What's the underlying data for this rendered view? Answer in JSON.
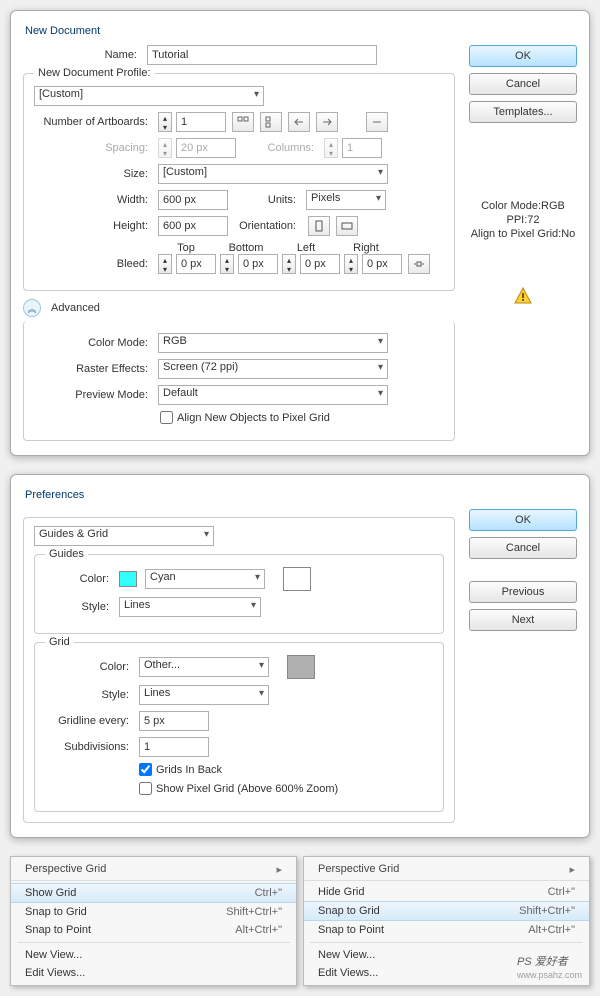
{
  "newdoc": {
    "title": "New Document",
    "name_label": "Name:",
    "name_value": "Tutorial",
    "profile_label": "New Document Profile:",
    "profile_value": "[Custom]",
    "artboards_label": "Number of Artboards:",
    "artboards_value": "1",
    "spacing_label": "Spacing:",
    "spacing_value": "20 px",
    "columns_label": "Columns:",
    "columns_value": "1",
    "size_label": "Size:",
    "size_value": "[Custom]",
    "width_label": "Width:",
    "width_value": "600 px",
    "units_label": "Units:",
    "units_value": "Pixels",
    "height_label": "Height:",
    "height_value": "600 px",
    "orientation_label": "Orientation:",
    "bleed_label": "Bleed:",
    "bleed": {
      "top_label": "Top",
      "top": "0 px",
      "bottom_label": "Bottom",
      "bottom": "0 px",
      "left_label": "Left",
      "left": "0 px",
      "right_label": "Right",
      "right": "0 px"
    },
    "advanced_label": "Advanced",
    "colormode_label": "Color Mode:",
    "colormode_value": "RGB",
    "raster_label": "Raster Effects:",
    "raster_value": "Screen (72 ppi)",
    "preview_label": "Preview Mode:",
    "preview_value": "Default",
    "align_label": "Align New Objects to Pixel Grid",
    "ok": "OK",
    "cancel": "Cancel",
    "templates": "Templates...",
    "info1": "Color Mode:RGB",
    "info2": "PPI:72",
    "info3": "Align to Pixel Grid:No"
  },
  "prefs": {
    "title": "Preferences",
    "section": "Guides & Grid",
    "guides_legend": "Guides",
    "guides_color_label": "Color:",
    "guides_color_value": "Cyan",
    "guides_swatch": "#33ffff",
    "guides_style_label": "Style:",
    "guides_style_value": "Lines",
    "grid_legend": "Grid",
    "grid_color_label": "Color:",
    "grid_color_value": "Other...",
    "grid_swatch": "#b0b0b0",
    "grid_style_label": "Style:",
    "grid_style_value": "Lines",
    "gridline_label": "Gridline every:",
    "gridline_value": "5 px",
    "subdiv_label": "Subdivisions:",
    "subdiv_value": "1",
    "gridsback_label": "Grids In Back",
    "showpixel_label": "Show Pixel Grid (Above 600% Zoom)",
    "ok": "OK",
    "cancel": "Cancel",
    "previous": "Previous",
    "next": "Next"
  },
  "menu1": {
    "head": "Perspective Grid",
    "items": [
      {
        "label": "Show Grid",
        "sc": "Ctrl+\"",
        "hl": true
      },
      {
        "label": "Snap to Grid",
        "sc": "Shift+Ctrl+\""
      },
      {
        "label": "Snap to Point",
        "sc": "Alt+Ctrl+\""
      }
    ],
    "tail": [
      {
        "label": "New View..."
      },
      {
        "label": "Edit Views..."
      }
    ]
  },
  "menu2": {
    "head": "Perspective Grid",
    "items": [
      {
        "label": "Hide Grid",
        "sc": "Ctrl+\""
      },
      {
        "label": "Snap to Grid",
        "sc": "Shift+Ctrl+\"",
        "hl": true
      },
      {
        "label": "Snap to Point",
        "sc": "Alt+Ctrl+\""
      }
    ],
    "tail": [
      {
        "label": "New View..."
      },
      {
        "label": "Edit Views..."
      }
    ]
  },
  "watermark": {
    "brand": "PS 爱好者",
    "url": "www.psahz.com"
  }
}
